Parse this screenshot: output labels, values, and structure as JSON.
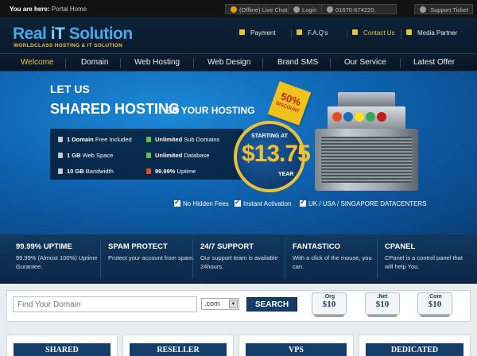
{
  "topbar": {
    "you_are_here": "You are here:",
    "location": "Portal Home",
    "live_chat": "(Offline) Live Chat",
    "login": "Login",
    "phone": "01670-674220,",
    "support": "Support Ticket"
  },
  "header": {
    "logo_real": "Real ",
    "logo_it": "iT",
    "logo_solution": " Solution",
    "logo_tagline": "WORLDCLASS HOSTING & IT SOLUTION",
    "links": [
      "Payment",
      "F.A.Q's",
      "Contact Us",
      "Media Partner"
    ]
  },
  "nav": [
    "Welcome",
    "Domain",
    "Web Hosting",
    "Web Design",
    "Brand SMS",
    "Our Service",
    "Latest Offer"
  ],
  "hero": {
    "let_us": "LET US",
    "shared_hosting": "SHARED HOSTING",
    "be_your": "BE YOUR HOSTING",
    "features": [
      {
        "bold": "1 Domain",
        "rest": " Free Included"
      },
      {
        "bold": "Unlimited",
        "rest": " Sub Domains"
      },
      {
        "bold": "1 GB",
        "rest": " Web Space"
      },
      {
        "bold": "Unlimited",
        "rest": " Database"
      },
      {
        "bold": "10 GB",
        "rest": " Bandwidth"
      },
      {
        "bold": "99.99%",
        "rest": " Uptime"
      }
    ],
    "starting_at": "STARTING AT",
    "price": "$13.75",
    "per": "YEAR",
    "badge_pct": "50%",
    "badge_text": "DISCOUNT",
    "checks": [
      "No Hidden Fees",
      "Instant Activation",
      "UK / USA / SINGAPORE DATACENTERS"
    ]
  },
  "strip": [
    {
      "title": "99.99% UPTIME",
      "desc": "99.99% (Almost 100%) Uptime Gurantee."
    },
    {
      "title": "SPAM PROTECT",
      "desc": "Protect your account from spam."
    },
    {
      "title": "24/7 SUPPORT",
      "desc": "Our support team is available 24hours."
    },
    {
      "title": "FANTASTICO",
      "desc": "With a click of the mouse, you can."
    },
    {
      "title": "CPANEL",
      "desc": "CPanel is a control panel that will help You."
    }
  ],
  "domain_search": {
    "placeholder": "Find Your Domain",
    "tld_selected": ".com",
    "button": "SEARCH",
    "tlds": [
      {
        "ext": ".Org",
        "price": "$10"
      },
      {
        "ext": ".Net",
        "price": "$10"
      },
      {
        "ext": ".Com",
        "price": "$10"
      }
    ]
  },
  "plans": [
    "SHARED",
    "RESELLER",
    "VPS",
    "DEDICATED"
  ],
  "colors": {
    "accent": "#e6c23c",
    "navy": "#143d6a",
    "hero_blue": "#0f63b0"
  }
}
